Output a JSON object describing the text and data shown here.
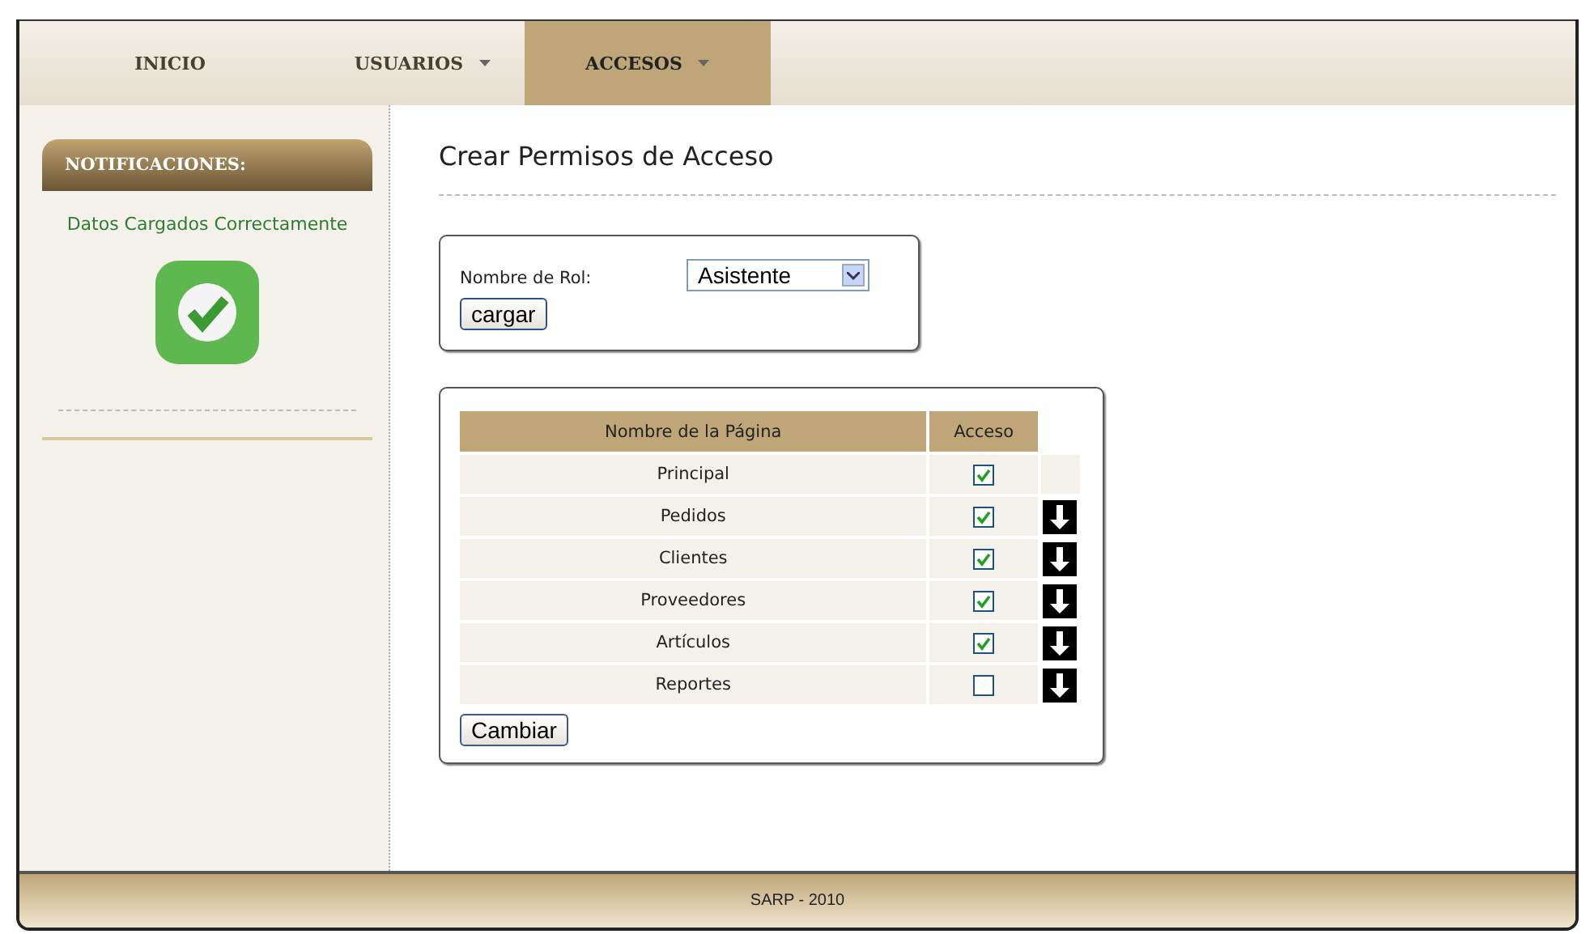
{
  "nav": [
    {
      "label": "INICIO",
      "dropdown": false,
      "selected": false
    },
    {
      "label": "USUARIOS",
      "dropdown": true,
      "selected": false
    },
    {
      "label": "ACCESOS",
      "dropdown": true,
      "selected": true
    }
  ],
  "sidebar": {
    "title": "NOTIFICACIONES:",
    "message": "Datos Cargados Correctamente"
  },
  "page_title": "Crear Permisos de Acceso",
  "role_form": {
    "label": "Nombre de Rol:",
    "value": "Asistente",
    "button": "cargar"
  },
  "table": {
    "columns": [
      "Nombre de la Página",
      "Acceso"
    ],
    "rows": [
      {
        "page": "Principal",
        "checked": true,
        "down_arrow": false
      },
      {
        "page": "Pedidos",
        "checked": true,
        "down_arrow": true
      },
      {
        "page": "Clientes",
        "checked": true,
        "down_arrow": true
      },
      {
        "page": "Proveedores",
        "checked": true,
        "down_arrow": true
      },
      {
        "page": "Artículos",
        "checked": true,
        "down_arrow": true
      },
      {
        "page": "Reportes",
        "checked": false,
        "down_arrow": true
      }
    ],
    "button": "Cambiar"
  },
  "footer": "SARP - 2010"
}
